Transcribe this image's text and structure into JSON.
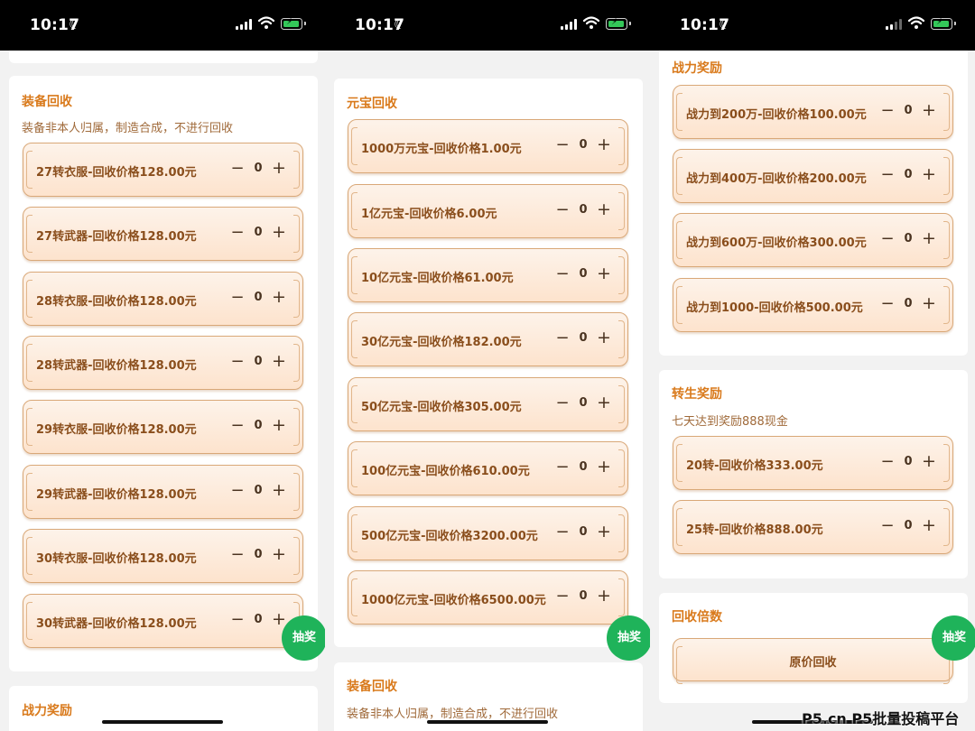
{
  "status": {
    "time": "10:17"
  },
  "lottery_label": "抽奖",
  "watermark": "P5.cn P5批量投稿平台",
  "p1": {
    "equip": {
      "title": "装备回收",
      "desc": "装备非本人归属，制造合成，不进行回收",
      "items": [
        {
          "label": "27转衣服-回收价格128.00元",
          "qty": "0"
        },
        {
          "label": "27转武器-回收价格128.00元",
          "qty": "0"
        },
        {
          "label": "28转衣服-回收价格128.00元",
          "qty": "0"
        },
        {
          "label": "28转武器-回收价格128.00元",
          "qty": "0"
        },
        {
          "label": "29转衣服-回收价格128.00元",
          "qty": "0"
        },
        {
          "label": "29转武器-回收价格128.00元",
          "qty": "0"
        },
        {
          "label": "30转衣服-回收价格128.00元",
          "qty": "0"
        },
        {
          "label": "30转武器-回收价格128.00元",
          "qty": "0"
        }
      ]
    },
    "power_title": "战力奖励"
  },
  "p2": {
    "yuanbao": {
      "title": "元宝回收",
      "items": [
        {
          "label": "1000万元宝-回收价格1.00元",
          "qty": "0"
        },
        {
          "label": "1亿元宝-回收价格6.00元",
          "qty": "0"
        },
        {
          "label": "10亿元宝-回收价格61.00元",
          "qty": "0"
        },
        {
          "label": "30亿元宝-回收价格182.00元",
          "qty": "0"
        },
        {
          "label": "50亿元宝-回收价格305.00元",
          "qty": "0"
        },
        {
          "label": "100亿元宝-回收价格610.00元",
          "qty": "0"
        },
        {
          "label": "500亿元宝-回收价格3200.00元",
          "qty": "0"
        },
        {
          "label": "1000亿元宝-回收价格6500.00元",
          "qty": "0"
        }
      ]
    },
    "equip": {
      "title": "装备回收",
      "desc": "装备非本人归属，制造合成，不进行回收"
    }
  },
  "p3": {
    "power": {
      "title": "战力奖励",
      "items": [
        {
          "label": "战力到200万-回收价格100.00元",
          "qty": "0"
        },
        {
          "label": "战力到400万-回收价格200.00元",
          "qty": "0"
        },
        {
          "label": "战力到600万-回收价格300.00元",
          "qty": "0"
        },
        {
          "label": "战力到1000-回收价格500.00元",
          "qty": "0"
        }
      ]
    },
    "rebirth": {
      "title": "转生奖励",
      "desc": "七天达到奖励888现金",
      "items": [
        {
          "label": "20转-回收价格333.00元",
          "qty": "0"
        },
        {
          "label": "25转-回收价格888.00元",
          "qty": "0"
        }
      ]
    },
    "multiplier": {
      "title": "回收倍数",
      "option": "原价回收"
    }
  }
}
